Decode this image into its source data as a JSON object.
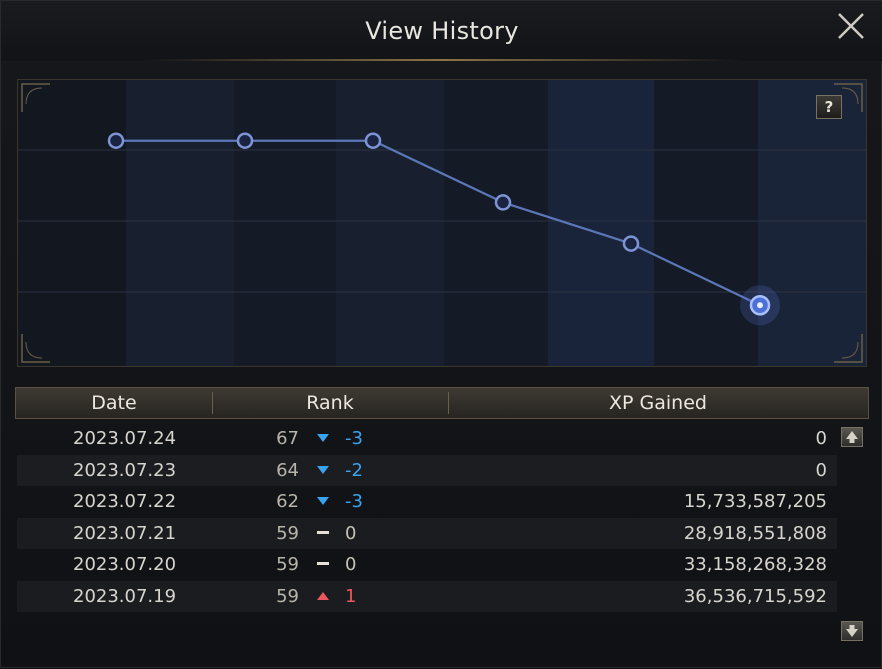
{
  "window": {
    "title": "View History",
    "close_icon": "close-icon"
  },
  "help": {
    "label": "?"
  },
  "table": {
    "headers": {
      "date": "Date",
      "rank": "Rank",
      "xp": "XP Gained"
    },
    "rows": [
      {
        "date": "2023.07.24",
        "rank": "67",
        "direction": "down",
        "delta": "-3",
        "xp": "0"
      },
      {
        "date": "2023.07.23",
        "rank": "64",
        "direction": "down",
        "delta": "-2",
        "xp": "0"
      },
      {
        "date": "2023.07.22",
        "rank": "62",
        "direction": "down",
        "delta": "-3",
        "xp": "15,733,587,205"
      },
      {
        "date": "2023.07.21",
        "rank": "59",
        "direction": "flat",
        "delta": "0",
        "xp": "28,918,551,808"
      },
      {
        "date": "2023.07.20",
        "rank": "59",
        "direction": "flat",
        "delta": "0",
        "xp": "33,158,268,328"
      },
      {
        "date": "2023.07.19",
        "rank": "59",
        "direction": "up",
        "delta": "1",
        "xp": "36,536,715,592"
      }
    ]
  },
  "chart_data": {
    "type": "line",
    "x": [
      "2023.07.19",
      "2023.07.20",
      "2023.07.21",
      "2023.07.22",
      "2023.07.23",
      "2023.07.24"
    ],
    "series": [
      {
        "values": [
          59,
          59,
          59,
          62,
          64,
          67
        ]
      }
    ],
    "ylim": [
      56,
      70
    ],
    "y_inverted": true,
    "grid": true,
    "highlighted_point": "2023.07.24"
  },
  "colors": {
    "line": "#5b77b8",
    "marker_fill": "#1a2440",
    "marker_stroke": "#7d95d6",
    "highlight": "#a9c2ff",
    "rank_down": "#3aa3ee",
    "rank_up": "#e8585e",
    "border_gold": "#8a7446"
  }
}
